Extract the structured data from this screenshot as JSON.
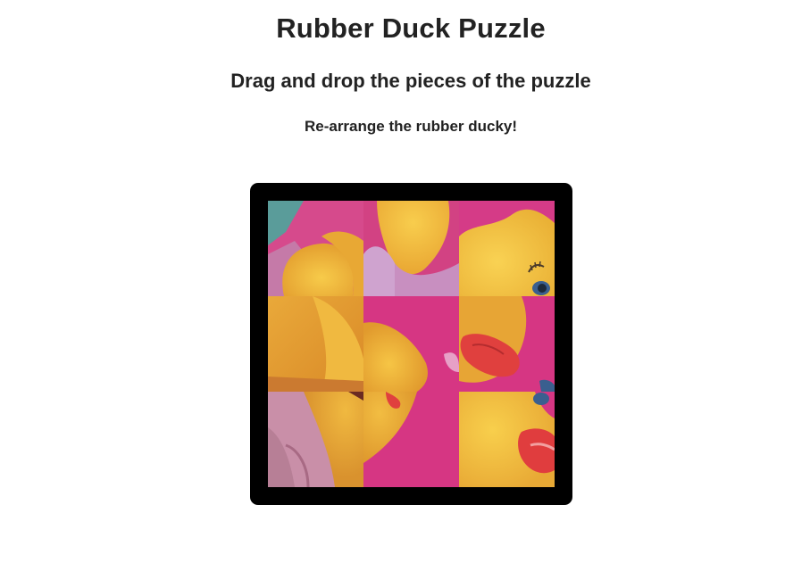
{
  "page": {
    "title": "Rubber Duck Puzzle",
    "subtitle": "Drag and drop the pieces of the puzzle",
    "instruction": "Re-arrange the rubber ducky!"
  },
  "puzzle": {
    "rows": 3,
    "columns": 3,
    "board_color": "#000000",
    "colors": {
      "magenta": "#d63b86",
      "duck_yellow": "#f4c13f",
      "duck_orange": "#e39a2c",
      "beak_red": "#e0403e",
      "pink_shadow": "#c9a2c9",
      "teal": "#5a9c9a"
    }
  }
}
